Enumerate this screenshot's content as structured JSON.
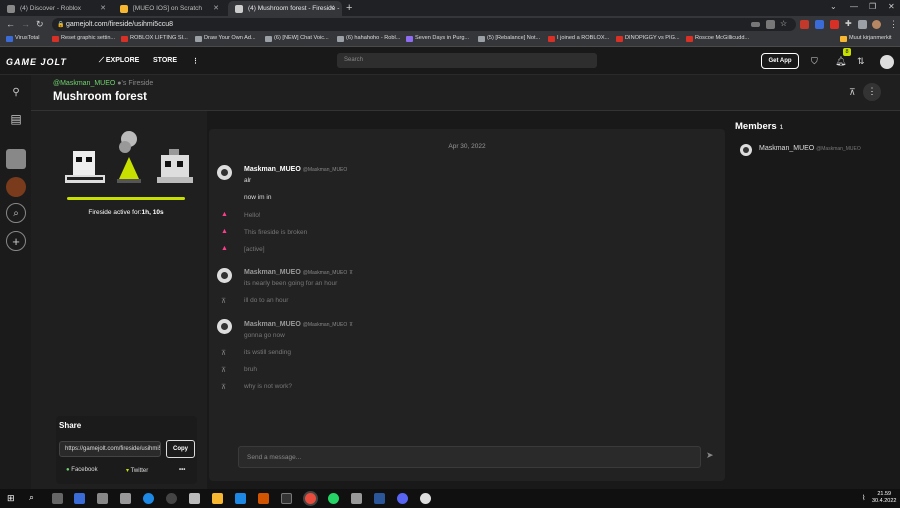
{
  "browser": {
    "tabs": [
      {
        "label": "(4) Discover - Roblox",
        "favicon_color": "#888888"
      },
      {
        "label": "[MUEO IOS] on Scratch",
        "favicon_color": "#f7b731"
      },
      {
        "label": "(4) Mushroom forest - Fireside -",
        "favicon_color": "#cccccc"
      }
    ],
    "new_tab": "+",
    "url": "gamejolt.com/fireside/usihmi5ccu8",
    "bookmarks": [
      {
        "label": "VirusTotal",
        "color": "#3b6bd6"
      },
      {
        "label": "Reset graphic settin...",
        "color": "#d93025"
      },
      {
        "label": "ROBLOX LIFTING SI...",
        "color": "#d93025"
      },
      {
        "label": "Draw Your Own Ad...",
        "color": "#9aa0a6"
      },
      {
        "label": "(6) [NEW] Chat Voic...",
        "color": "#9aa0a6"
      },
      {
        "label": "(6) hahahoho - Robl...",
        "color": "#9aa0a6"
      },
      {
        "label": "Seven Days in Purg...",
        "color": "#8e6df1"
      },
      {
        "label": "(5) [Rebalance] Not...",
        "color": "#9aa0a6"
      },
      {
        "label": "I joined a ROBLOX...",
        "color": "#d93025"
      },
      {
        "label": "DINOPIGGY vs PIG...",
        "color": "#d93025"
      },
      {
        "label": "Roscoe McGillicudd...",
        "color": "#d93025"
      },
      {
        "label": "Muut kirjanmerkit",
        "color": "#f7b731"
      }
    ]
  },
  "gj_nav": {
    "logo": "GAME JOLT",
    "explore": "EXPLORE",
    "store": "STORE",
    "more": "⋮",
    "search_placeholder": "Search",
    "get_app": "Get App",
    "notif_badge": "8"
  },
  "header": {
    "owner": "@Maskman_MUEO",
    "owner_suffix": "'s Fireside",
    "title": "Mushroom forest"
  },
  "fireside": {
    "active_label": "Fireside active for:",
    "active_time": "1h, 10s",
    "progress": 1.0
  },
  "share": {
    "title": "Share",
    "url": "https://gamejolt.com/fireside/usihmi5ccu8",
    "copy": "Copy",
    "facebook": "Facebook",
    "twitter": "Twitter",
    "more": "•••"
  },
  "chat": {
    "date": "Apr 30, 2022",
    "username": "Maskman_MUEO",
    "handle": "@Maskman_MUEO",
    "messages": [
      {
        "kind": "first",
        "text": "alr"
      },
      {
        "kind": "plain",
        "text": "now im in"
      },
      {
        "kind": "warn",
        "text": "Hello!"
      },
      {
        "kind": "warn",
        "text": "This fireside is broken"
      },
      {
        "kind": "warn",
        "text": "[active]"
      },
      {
        "kind": "first-pin",
        "text": "its nearly been going for an hour"
      },
      {
        "kind": "pin",
        "text": "ill do to an hour"
      },
      {
        "kind": "first-pin",
        "text": "gonna go now"
      },
      {
        "kind": "pin",
        "text": "its wstill sending"
      },
      {
        "kind": "pin",
        "text": "bruh"
      },
      {
        "kind": "pin",
        "text": "why is not work?"
      }
    ],
    "composer_placeholder": "Send a message..."
  },
  "members": {
    "title": "Members",
    "count": "1",
    "list": [
      {
        "name": "Maskman_MUEO",
        "handle": "@Maskman_MUEO"
      }
    ]
  },
  "taskbar": {
    "time": "21.59",
    "date": "30.4.2022"
  }
}
